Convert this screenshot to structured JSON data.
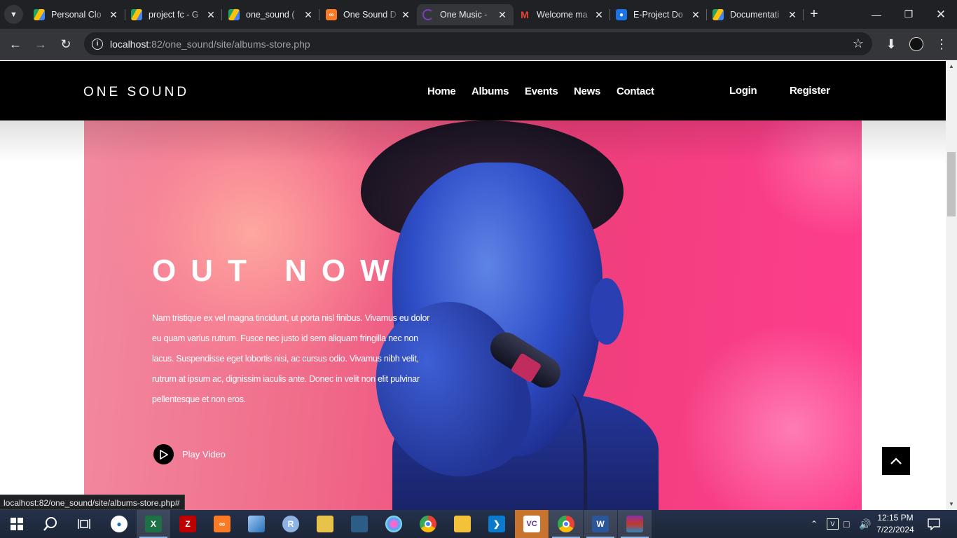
{
  "browser": {
    "tabs": [
      {
        "title": "Personal Clo",
        "icon": "google-drive-icon",
        "active": false
      },
      {
        "title": "project fc - G",
        "icon": "google-drive-icon",
        "active": false
      },
      {
        "title": "one_sound (",
        "icon": "google-drive-icon",
        "active": false
      },
      {
        "title": "One Sound D",
        "icon": "xampp-icon",
        "active": false
      },
      {
        "title": "One Music -",
        "icon": "loading-spinner-icon",
        "active": true
      },
      {
        "title": "Welcome ma",
        "icon": "gmail-icon",
        "active": false
      },
      {
        "title": "E-Project Do",
        "icon": "google-classroom-icon",
        "active": false
      },
      {
        "title": "Documentati",
        "icon": "google-drive-icon",
        "active": false
      }
    ],
    "url_host": "localhost",
    "url_rest": ":82/one_sound/site/albums-store.php",
    "status_url": "localhost:82/one_sound/site/albums-store.php#"
  },
  "site": {
    "logo": "ONE SOUND",
    "nav": {
      "home": "Home",
      "albums": "Albums",
      "events": "Events",
      "news": "News",
      "contact": "Contact",
      "login": "Login",
      "register": "Register"
    },
    "hero": {
      "title": "OUT NOW",
      "text": "Nam tristique ex vel magna tincidunt, ut porta nisl finibus. Vivamus eu dolor eu quam varius rutrum. Fusce nec justo id sem aliquam fringilla nec non lacus. Suspendisse eget lobortis nisi, ac cursus odio. Vivamus nibh velit, rutrum at ipsum ac, dignissim iaculis ante. Donec in velit non elit pulvinar pellentesque et non eros.",
      "play_label": "Play Video"
    }
  },
  "taskbar": {
    "time": "12:15 PM",
    "date": "7/22/2024",
    "apps": [
      "ms-paint-icon",
      "excel-icon",
      "filezilla-icon",
      "xampp-icon",
      "virtualbox-icon",
      "r-icon",
      "sticky-notes-icon",
      "mysql-workbench-icon",
      "paint-palette-icon",
      "chrome-icon",
      "file-explorer-icon",
      "vscode-icon",
      "vs-icon",
      "chrome-profile-icon",
      "word-icon",
      "winrar-icon"
    ]
  },
  "colors": {
    "chrome_dark": "#202124",
    "chrome_toolbar": "#35363a",
    "hero_pink": "#ee3f7b",
    "face_blue": "#2f4fc9"
  }
}
